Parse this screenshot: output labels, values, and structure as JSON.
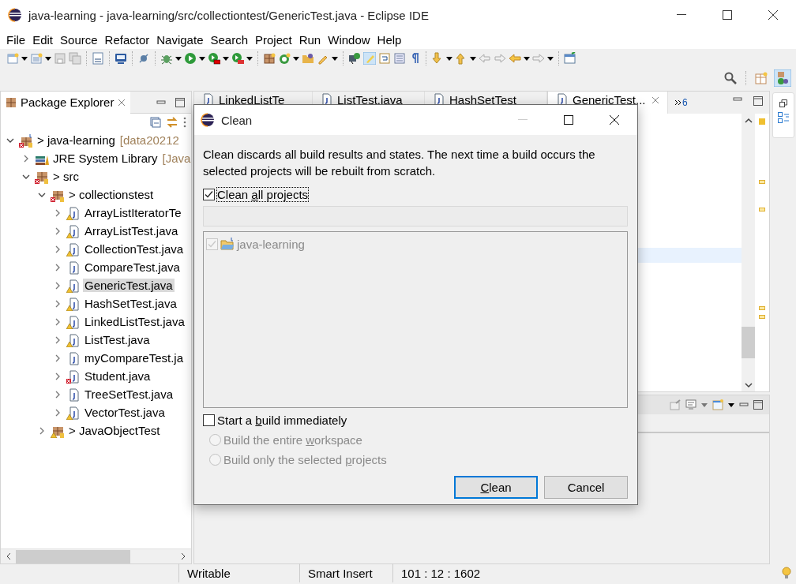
{
  "window": {
    "title": "java-learning - java-learning/src/collectiontest/GenericTest.java - Eclipse IDE"
  },
  "menu": [
    "File",
    "Edit",
    "Source",
    "Refactor",
    "Navigate",
    "Search",
    "Project",
    "Run",
    "Window",
    "Help"
  ],
  "package_explorer": {
    "title": "Package Explorer",
    "tree": [
      {
        "label": "> java-learning",
        "decoration": "[data20212",
        "kind": "project",
        "warning": false,
        "error": true,
        "expanded": true,
        "selected": false,
        "children": [
          {
            "label": "JRE System Library",
            "decoration": "[Java",
            "kind": "library",
            "warning": false,
            "error": false,
            "expanded": false,
            "selected": false
          },
          {
            "label": "> src",
            "kind": "source",
            "warning": false,
            "error": true,
            "expanded": true,
            "selected": false,
            "children": [
              {
                "label": "> collectionstest",
                "kind": "package",
                "warning": false,
                "error": true,
                "expanded": true,
                "selected": false,
                "children": [
                  {
                    "label": "ArrayListIteratorTe",
                    "kind": "file",
                    "warning": true,
                    "error": false,
                    "expanded": false,
                    "selected": false
                  },
                  {
                    "label": "ArrayListTest.java",
                    "kind": "file",
                    "warning": true,
                    "error": false,
                    "expanded": false,
                    "selected": false
                  },
                  {
                    "label": "CollectionTest.java",
                    "kind": "file",
                    "warning": true,
                    "error": false,
                    "expanded": false,
                    "selected": false
                  },
                  {
                    "label": "CompareTest.java",
                    "kind": "file",
                    "warning": false,
                    "error": false,
                    "expanded": false,
                    "selected": false
                  },
                  {
                    "label": "GenericTest.java",
                    "kind": "file",
                    "warning": true,
                    "error": false,
                    "expanded": false,
                    "selected": true
                  },
                  {
                    "label": "HashSetTest.java",
                    "kind": "file",
                    "warning": true,
                    "error": false,
                    "expanded": false,
                    "selected": false
                  },
                  {
                    "label": "LinkedListTest.java",
                    "kind": "file",
                    "warning": true,
                    "error": false,
                    "expanded": false,
                    "selected": false
                  },
                  {
                    "label": "ListTest.java",
                    "kind": "file",
                    "warning": true,
                    "error": false,
                    "expanded": false,
                    "selected": false
                  },
                  {
                    "label": "myCompareTest.ja",
                    "kind": "file",
                    "warning": false,
                    "error": false,
                    "expanded": false,
                    "selected": false
                  },
                  {
                    "label": "Student.java",
                    "kind": "file",
                    "warning": false,
                    "error": true,
                    "expanded": false,
                    "selected": false
                  },
                  {
                    "label": "TreeSetTest.java",
                    "kind": "file",
                    "warning": false,
                    "error": false,
                    "expanded": false,
                    "selected": false
                  },
                  {
                    "label": "VectorTest.java",
                    "kind": "file",
                    "warning": true,
                    "error": false,
                    "expanded": false,
                    "selected": false
                  }
                ]
              },
              {
                "label": "> JavaObjectTest",
                "kind": "package",
                "warning": true,
                "error": false,
                "expanded": false,
                "selected": false
              }
            ]
          }
        ]
      }
    ]
  },
  "editor_tabs": {
    "tabs": [
      {
        "label": "LinkedListTe",
        "selected": false
      },
      {
        "label": "ListTest.java",
        "selected": false
      },
      {
        "label": "HashSetTest",
        "selected": false
      },
      {
        "label": "GenericTest...",
        "selected": true
      }
    ],
    "overflow_count": "6"
  },
  "dialog": {
    "title": "Clean",
    "description": "Clean discards all build results and states. The next time a build occurs the selected projects will be rebuilt from scratch.",
    "clean_all": {
      "label": {
        "before": "Clean ",
        "mnemonic": "a",
        "after": "ll projects"
      },
      "checked": true
    },
    "projects": [
      {
        "label": "java-learning",
        "checked": true,
        "disabled": true
      }
    ],
    "build_now": {
      "label": {
        "before": "Start a ",
        "mnemonic": "b",
        "after": "uild immediately"
      },
      "checked": false
    },
    "build_options": [
      {
        "label": {
          "before": "Build the entire ",
          "mnemonic": "w",
          "after": "orkspace"
        },
        "selected": false,
        "disabled": true
      },
      {
        "label": {
          "before": "Build only the selected ",
          "mnemonic": "p",
          "after": "rojects"
        },
        "selected": false,
        "disabled": true
      }
    ],
    "buttons": [
      {
        "label": {
          "mnemonic": "C",
          "after": "lean"
        },
        "default": true
      },
      {
        "label": {
          "before": "Cancel"
        },
        "default": false
      }
    ]
  },
  "status_bar": [
    "Writable",
    "Smart Insert",
    "101 : 12 : 1602"
  ]
}
